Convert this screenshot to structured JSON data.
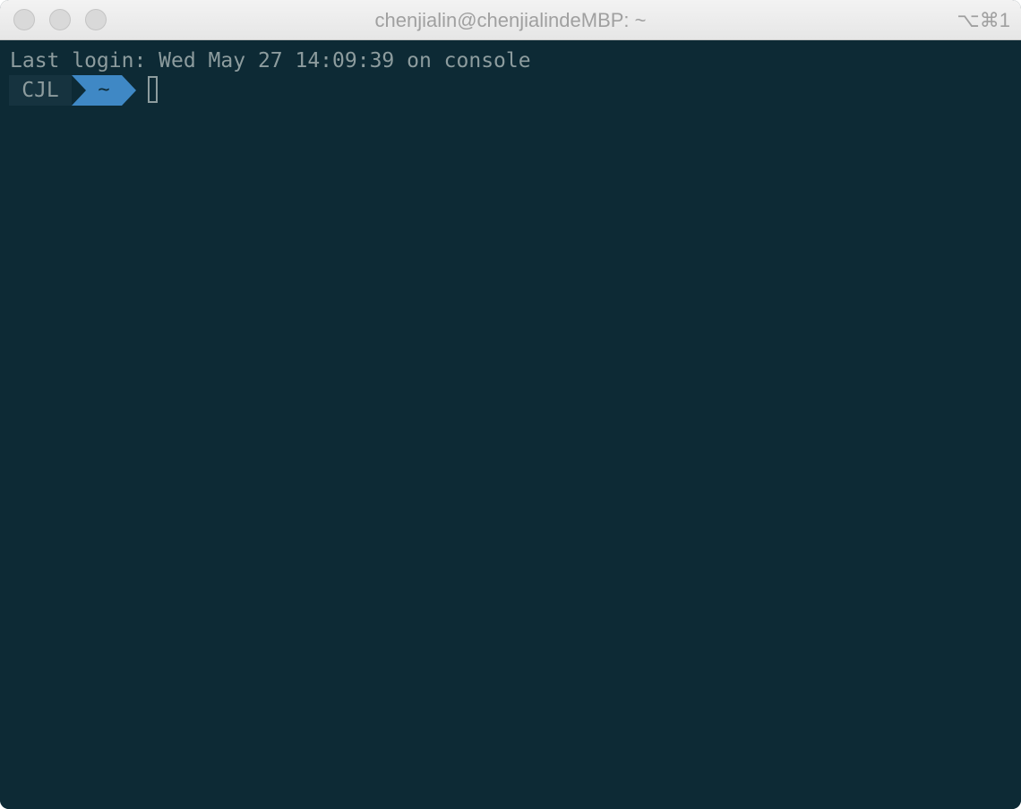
{
  "window": {
    "title": "chenjialin@chenjialindeMBP: ~",
    "shortcut": "⌥⌘1",
    "controls": [
      "close",
      "minimize",
      "zoom"
    ]
  },
  "terminal": {
    "last_login_line": "Last login: Wed May 27 14:09:39 on console",
    "prompt": {
      "user_segment": "CJL",
      "dir_segment": "~"
    },
    "colors": {
      "background": "#0d2a35",
      "foreground": "#8d9c9e",
      "dir_segment_bg": "#3f88c5",
      "user_segment_bg": "#16333f"
    }
  }
}
